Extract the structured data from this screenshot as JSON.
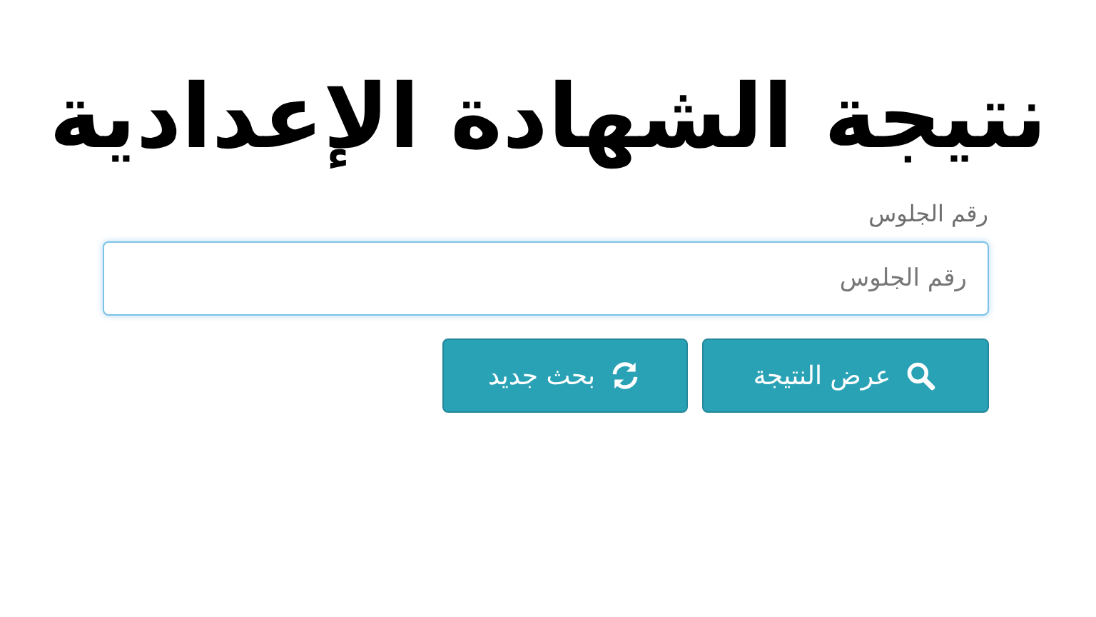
{
  "title": "نتيجة الشهادة الإعدادية",
  "form": {
    "label": "رقم الجلوس",
    "field": {
      "placeholder": "رقم الجلوس",
      "focused": true
    },
    "buttons": [
      {
        "label": "عرض النتيجة",
        "kind": "search"
      },
      {
        "label": "بحث جديد",
        "kind": "reset"
      }
    ]
  }
}
